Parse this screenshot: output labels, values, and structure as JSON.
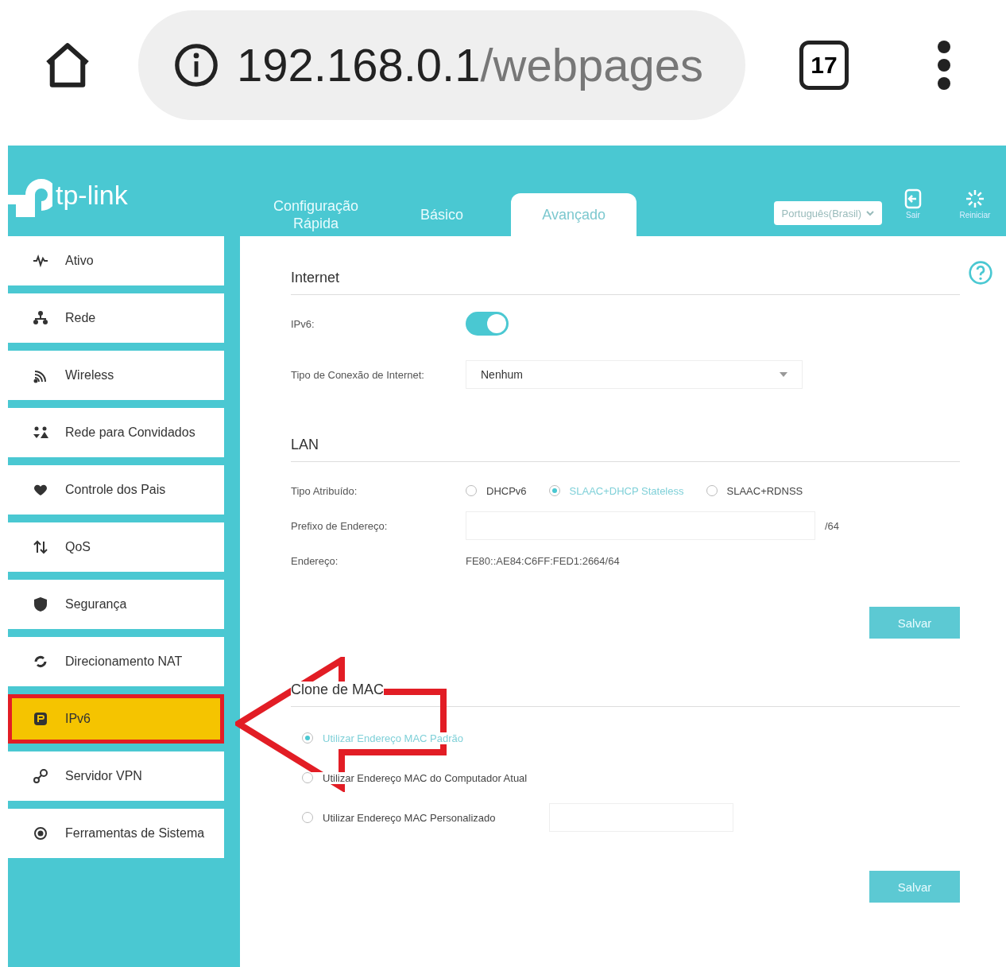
{
  "browser": {
    "url_host": "192.168.0.1",
    "url_path": "/webpages",
    "tab_count": "17"
  },
  "header": {
    "logo_text": "tp-link",
    "tabs": [
      {
        "label": "Configuração\nRápida",
        "selected": false
      },
      {
        "label": "Básico",
        "selected": false
      },
      {
        "label": "Avançado",
        "selected": true
      }
    ],
    "language": "Português(Brasil)",
    "actions": [
      {
        "label": "Sair",
        "kind": "logout"
      },
      {
        "label": "Reiniciar",
        "kind": "reboot"
      }
    ]
  },
  "sidebar": {
    "items": [
      {
        "label": "Ativo",
        "selected": false
      },
      {
        "label": "Rede",
        "selected": false
      },
      {
        "label": "Wireless",
        "selected": false
      },
      {
        "label": "Rede para Convidados",
        "selected": false
      },
      {
        "label": "Controle dos Pais",
        "selected": false
      },
      {
        "label": "QoS",
        "selected": false
      },
      {
        "label": "Segurança",
        "selected": false
      },
      {
        "label": "Direcionamento NAT",
        "selected": false
      },
      {
        "label": "IPv6",
        "selected": true
      },
      {
        "label": "Servidor VPN",
        "selected": false
      },
      {
        "label": "Ferramentas de Sistema",
        "selected": false
      }
    ]
  },
  "internet": {
    "title": "Internet",
    "ipv6": {
      "label": "IPv6:",
      "on": true
    },
    "connection_type": {
      "label": "Tipo de Conexão de Internet:",
      "value": "Nenhum"
    }
  },
  "lan": {
    "title": "LAN",
    "assigned_type": {
      "label": "Tipo Atribuído:",
      "options": [
        {
          "label": "DHCPv6",
          "selected": false
        },
        {
          "label": "SLAAC+DHCP Stateless",
          "selected": true
        },
        {
          "label": "SLAAC+RDNSS",
          "selected": false
        }
      ]
    },
    "prefix": {
      "label": "Prefixo de Endereço:",
      "suffix": "/64"
    },
    "address": {
      "label": "Endereço:",
      "value": "FE80::AE84:C6FF:FED1:2664/64"
    },
    "save": "Salvar"
  },
  "mac_clone": {
    "title": "Clone de MAC",
    "options": [
      {
        "label": "Utilizar Endereço MAC Padrão",
        "selected": true,
        "kind": "plain"
      },
      {
        "label": "Utilizar Endereço MAC do Computador Atual",
        "selected": false,
        "kind": "plain"
      },
      {
        "label": "Utilizar Endereço MAC Personalizado",
        "selected": false,
        "kind": "input"
      }
    ],
    "save": "Salvar"
  }
}
